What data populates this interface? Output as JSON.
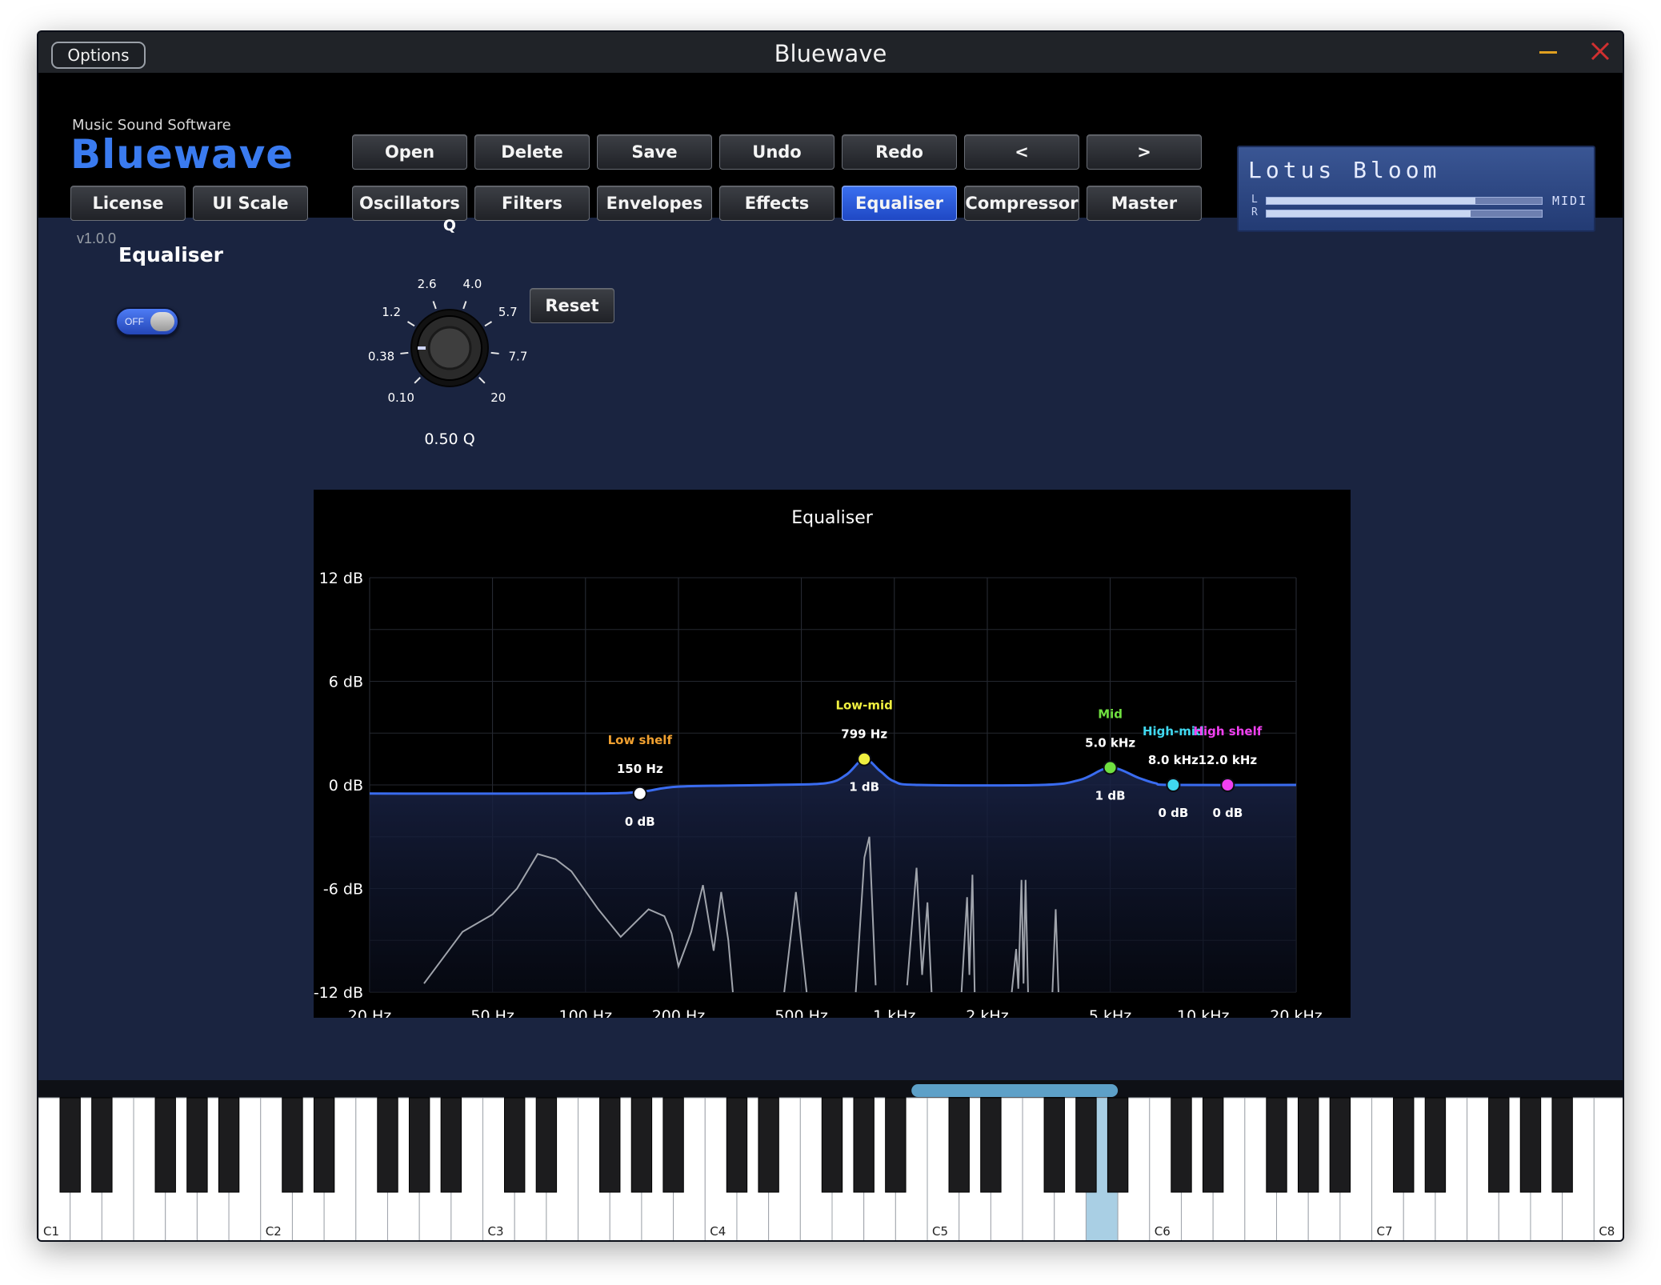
{
  "window": {
    "title": "Bluewave",
    "options_label": "Options",
    "minimize_color": "#e0a020",
    "close_color": "#d03030"
  },
  "header": {
    "brand_subtitle": "Music Sound Software",
    "brand_name": "Bluewave",
    "version": "v1.0.0",
    "top_row": [
      "Open",
      "Delete",
      "Save",
      "Undo",
      "Redo",
      "<",
      ">"
    ],
    "side_row": [
      "License",
      "UI Scale"
    ],
    "nav_row": [
      "Oscillators",
      "Filters",
      "Envelopes",
      "Effects",
      "Equaliser",
      "Compressor",
      "Master"
    ],
    "active_tab": "Equaliser"
  },
  "display": {
    "preset_name": "Lotus Bloom",
    "left_label": "L",
    "right_label": "R",
    "left_level": 0.76,
    "right_level": 0.74,
    "midi_label": "MIDI"
  },
  "equaliser": {
    "section_title": "Equaliser",
    "toggle_text": "OFF",
    "toggle_on": true,
    "reset_label": "Reset",
    "q_knob": {
      "label": "Q",
      "ticks": [
        "0.10",
        "0.38",
        "1.2",
        "2.6",
        "4.0",
        "5.7",
        "7.7",
        "20"
      ],
      "value_text": "0.50 Q"
    }
  },
  "chart_data": {
    "type": "line",
    "title": "Equaliser",
    "x_scale": "log",
    "x_ticks": [
      {
        "label": "20 Hz",
        "hz": 20
      },
      {
        "label": "50 Hz",
        "hz": 50
      },
      {
        "label": "100 Hz",
        "hz": 100
      },
      {
        "label": "200 Hz",
        "hz": 200
      },
      {
        "label": "500 Hz",
        "hz": 500
      },
      {
        "label": "1 kHz",
        "hz": 1000
      },
      {
        "label": "2 kHz",
        "hz": 2000
      },
      {
        "label": "5 kHz",
        "hz": 5000
      },
      {
        "label": "10 kHz",
        "hz": 10000
      },
      {
        "label": "20 kHz",
        "hz": 20000
      }
    ],
    "xlim": [
      20,
      20000
    ],
    "y_ticks": [
      {
        "label": "12 dB",
        "db": 12
      },
      {
        "label": "6 dB",
        "db": 6
      },
      {
        "label": "0 dB",
        "db": 0
      },
      {
        "label": "-6 dB",
        "db": -6
      },
      {
        "label": "-12 dB",
        "db": -12
      }
    ],
    "ylim": [
      -12,
      12
    ],
    "bands": [
      {
        "name": "Low shelf",
        "freq_label": "150 Hz",
        "gain_label": "0 dB",
        "hz": 150,
        "db": -0.5,
        "color": "#f0a030"
      },
      {
        "name": "Low-mid",
        "freq_label": "799 Hz",
        "gain_label": "1 dB",
        "hz": 799,
        "db": 1.5,
        "color": "#f0f040"
      },
      {
        "name": "Mid",
        "freq_label": "5.0 kHz",
        "gain_label": "1 dB",
        "hz": 5000,
        "db": 1.0,
        "color": "#70e040"
      },
      {
        "name": "High-mid",
        "freq_label": "8.0 kHz",
        "gain_label": "0 dB",
        "hz": 8000,
        "db": 0,
        "color": "#40d8f0"
      },
      {
        "name": "High shelf",
        "freq_label": "12.0 kHz",
        "gain_label": "0 dB",
        "hz": 12000,
        "db": 0,
        "color": "#f040f0"
      }
    ],
    "response_curve": {
      "color": "#3a6cf0",
      "points": [
        [
          20,
          -0.5
        ],
        [
          100,
          -0.5
        ],
        [
          150,
          -0.4
        ],
        [
          200,
          -0.1
        ],
        [
          400,
          0
        ],
        [
          600,
          0.1
        ],
        [
          700,
          0.6
        ],
        [
          799,
          1.5
        ],
        [
          900,
          0.8
        ],
        [
          1000,
          0.2
        ],
        [
          1200,
          0
        ],
        [
          3000,
          0
        ],
        [
          4000,
          0.3
        ],
        [
          5000,
          1.0
        ],
        [
          6200,
          0.4
        ],
        [
          7000,
          0.1
        ],
        [
          8000,
          0
        ],
        [
          20000,
          0
        ]
      ]
    },
    "spectrum": {
      "color": "#a0a4ac",
      "segments": [
        [
          [
            30,
            -11.5
          ],
          [
            40,
            -8.5
          ],
          [
            50,
            -7.5
          ],
          [
            60,
            -6
          ],
          [
            70,
            -4
          ],
          [
            80,
            -4.3
          ],
          [
            90,
            -5
          ],
          [
            110,
            -7.2
          ],
          [
            130,
            -8.8
          ],
          [
            160,
            -7.2
          ],
          [
            180,
            -7.6
          ],
          [
            190,
            -8.6
          ],
          [
            200,
            -10.5
          ],
          [
            220,
            -8.5
          ],
          [
            240,
            -5.8
          ],
          [
            260,
            -9.6
          ],
          [
            275,
            -6.2
          ],
          [
            290,
            -9
          ],
          [
            300,
            -12
          ]
        ],
        [
          [
            440,
            -12
          ],
          [
            480,
            -6.2
          ],
          [
            520,
            -12
          ]
        ],
        [
          [
            750,
            -12
          ],
          [
            800,
            -4.2
          ],
          [
            830,
            -3
          ],
          [
            870,
            -11.6
          ]
        ],
        [
          [
            1100,
            -11.6
          ],
          [
            1180,
            -4.8
          ],
          [
            1230,
            -11
          ],
          [
            1280,
            -6.8
          ],
          [
            1320,
            -12
          ]
        ],
        [
          [
            1650,
            -12
          ],
          [
            1720,
            -6.5
          ],
          [
            1750,
            -11
          ],
          [
            1790,
            -5.2
          ],
          [
            1820,
            -12
          ]
        ],
        [
          [
            2400,
            -12
          ],
          [
            2480,
            -9.5
          ],
          [
            2520,
            -11.8
          ],
          [
            2580,
            -5.5
          ],
          [
            2620,
            -11.5
          ],
          [
            2660,
            -5.5
          ],
          [
            2710,
            -12
          ]
        ],
        [
          [
            3250,
            -12
          ],
          [
            3330,
            -7.2
          ],
          [
            3400,
            -12
          ]
        ]
      ]
    }
  },
  "keyboard": {
    "octave_labels": [
      "C1",
      "C2",
      "C3",
      "C4",
      "C5",
      "C6",
      "C7",
      "C8"
    ],
    "white_key_count": 50,
    "highlighted_white_key": 33,
    "highlight_color": "#a9cfe4",
    "scroll_range": [
      0.55,
      0.68
    ]
  }
}
